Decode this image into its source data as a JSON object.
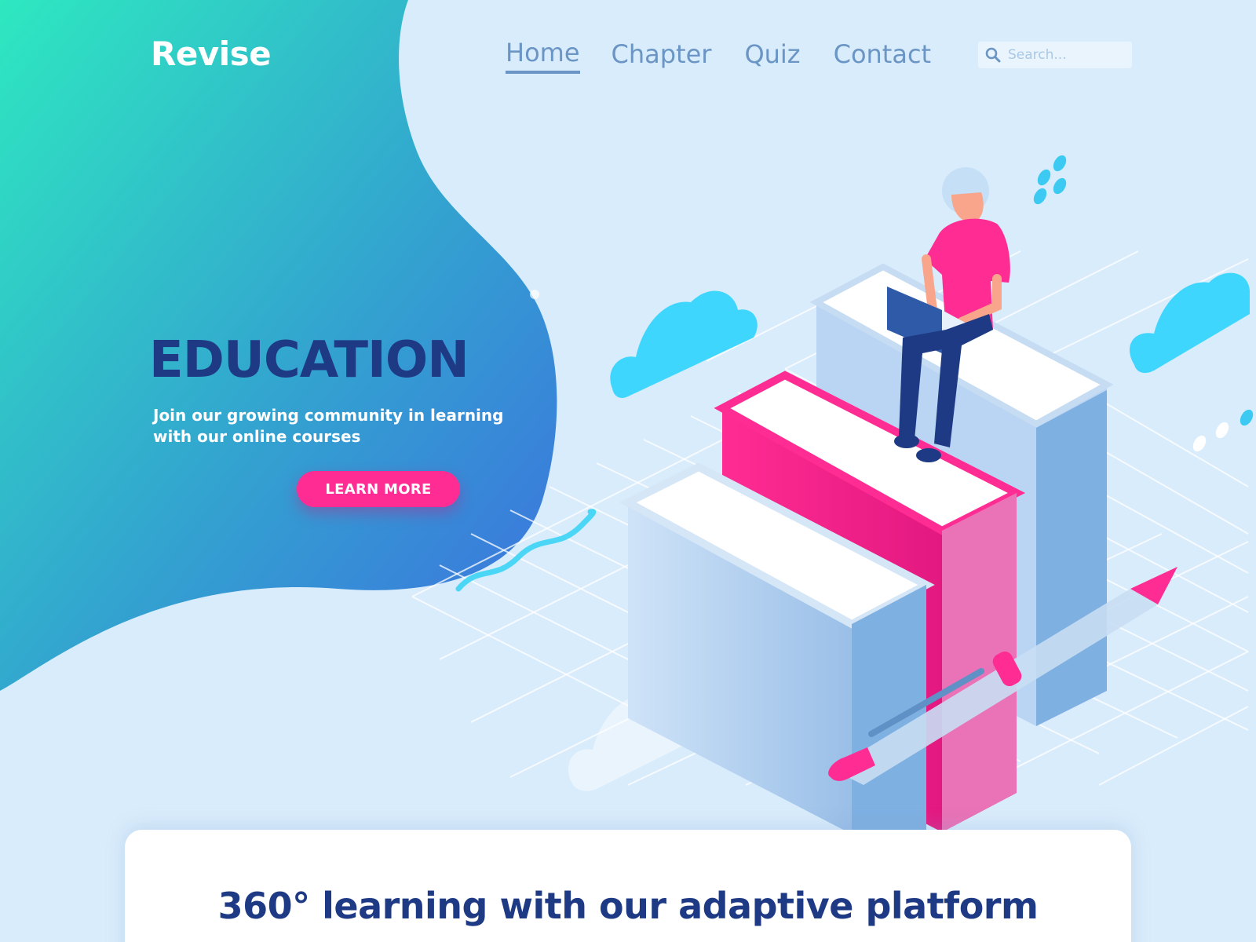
{
  "brand": {
    "logo": "Revise",
    "accent": "#ff2c93",
    "primary_dark": "#1f3a84",
    "nav_color": "#6a95c4",
    "gradient_start": "#2ee8c0",
    "gradient_end": "#3d6ee0"
  },
  "nav": {
    "items": [
      {
        "label": "Home",
        "active": true
      },
      {
        "label": "Chapter",
        "active": false
      },
      {
        "label": "Quiz",
        "active": false
      },
      {
        "label": "Contact",
        "active": false
      }
    ]
  },
  "search": {
    "placeholder": "Search...",
    "value": "",
    "icon": "search-icon"
  },
  "hero": {
    "title": "EDUCATION",
    "subtitle": "Join our growing community in learning with our online courses",
    "cta_label": "LEARN MORE"
  },
  "card": {
    "title": "360° learning with our adaptive platform"
  },
  "illustration": {
    "subject": "student-on-books",
    "icons": [
      "cloud-icon",
      "book-icon",
      "pen-icon",
      "laptop-icon"
    ]
  }
}
